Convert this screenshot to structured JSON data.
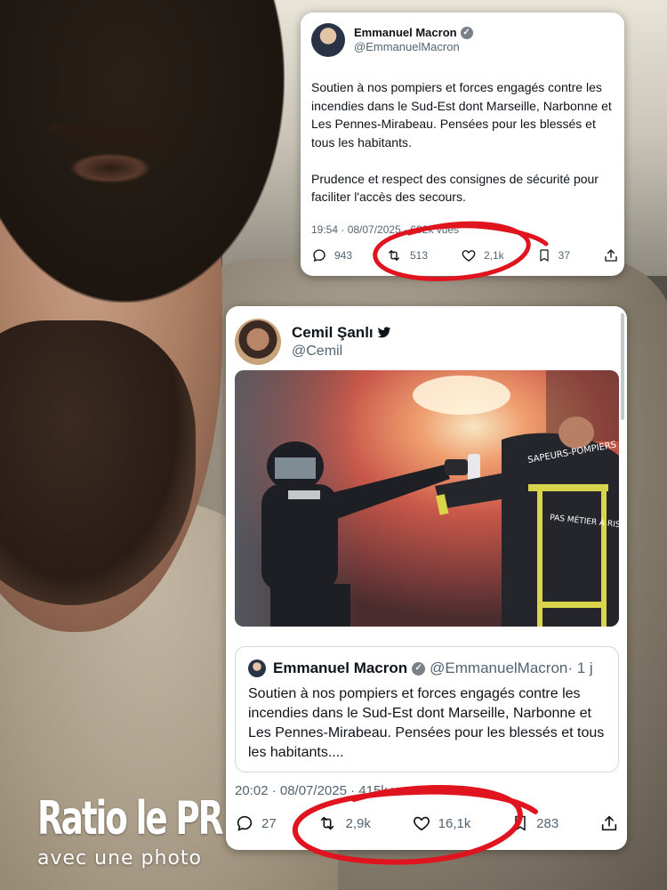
{
  "tweet1": {
    "author_name": "Emmanuel Macron",
    "author_handle": "@EmmanuelMacron",
    "text": "Soutien à nos pompiers et forces engagés contre les incendies dans le Sud-Est dont Marseille, Narbonne et Les Pennes-Mirabeau. Pensées pour les blessés et tous les habitants.\n\nPrudence et respect des consignes de sécurité pour faciliter l'accès des secours.",
    "timestamp": "19:54 · 08/07/2025 · ",
    "views": "692k vues",
    "replies": "943",
    "retweets": "513",
    "likes": "2,1k",
    "bookmarks": "37"
  },
  "tweet2": {
    "author_name": "Cemil Şanlı",
    "author_handle": "@Cemil",
    "quoted": {
      "author_name": "Emmanuel Macron",
      "author_handle": "@EmmanuelMacron",
      "age": "· 1 j",
      "text": "Soutien à nos pompiers et forces engagés contre les incendies dans le Sud-Est dont Marseille, Narbonne et Les Pennes-Mirabeau. Pensées pour les blessés et tous les habitants...."
    },
    "photo_texts": {
      "jacket_back": "SAPEURS-POMPIERS EN COLÈRE",
      "jacket_tag": "PAS MÉTIER À RISQUE"
    },
    "timestamp": "20:02 · 08/07/2025 · ",
    "views": "415k vues",
    "replies": "27",
    "retweets": "2,9k",
    "likes": "16,1k",
    "bookmarks": "283"
  },
  "overlay": {
    "title": "Ratio le PR",
    "subtitle": "avec une photo"
  },
  "colors": {
    "card_bg": "#ffffff",
    "text": "#0f1419",
    "muted": "#536471",
    "annotation_red": "#e0141e"
  },
  "icons": [
    "verified-badge-icon",
    "twitter-bird-icon",
    "reply-icon",
    "retweet-icon",
    "like-icon",
    "bookmark-icon",
    "share-icon"
  ]
}
